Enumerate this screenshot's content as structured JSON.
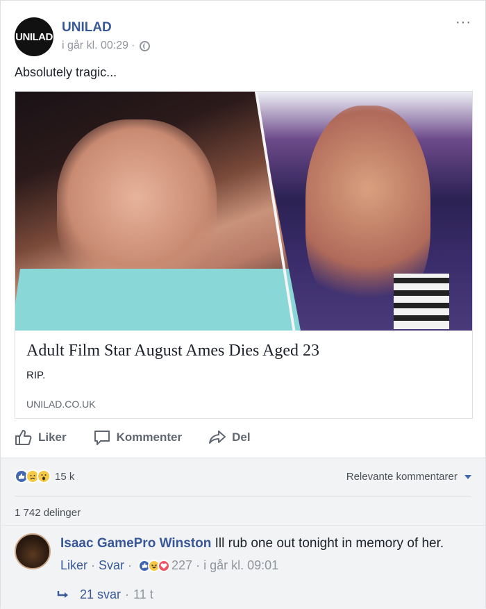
{
  "post": {
    "page_name": "UNILAD",
    "logo_text": "UNILAD",
    "timestamp": "i går kl. 00:29",
    "meta_sep": "·",
    "more_label": "···",
    "text": "Absolutely tragic..."
  },
  "link": {
    "title": "Adult Film Star August Ames Dies Aged 23",
    "description": "RIP.",
    "domain": "UNILAD.CO.UK"
  },
  "actions": {
    "like": "Liker",
    "comment": "Kommenter",
    "share": "Del"
  },
  "summary": {
    "reaction_count": "15 k",
    "sort_label": "Relevante kommentarer",
    "shares": "1 742 delinger"
  },
  "comment": {
    "author": "Isaac GamePro Winston",
    "text": "Ill rub one out tonight in memory of her.",
    "like": "Liker",
    "reply": "Svar",
    "dot": "·",
    "reaction_count": "227",
    "time": "i går kl. 09:01",
    "replies": "21 svar",
    "replies_time": "11 t"
  },
  "colors": {
    "link_blue": "#385898",
    "like_blue": "#4267b2",
    "muted": "#90949c"
  }
}
